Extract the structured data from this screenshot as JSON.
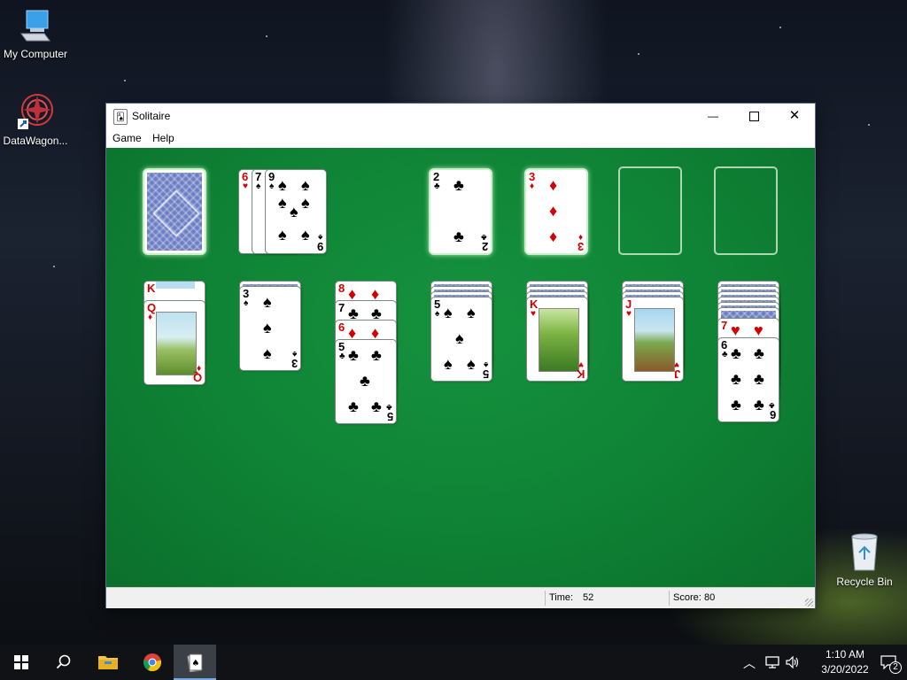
{
  "desktop": {
    "icons": [
      {
        "label": "My Computer",
        "icon": "computer-icon"
      },
      {
        "label": "DataWagon...",
        "icon": "datawagon-icon"
      },
      {
        "label": "Recycle Bin",
        "icon": "recycle-bin-icon"
      }
    ]
  },
  "window": {
    "title": "Solitaire",
    "menu": {
      "game": "Game",
      "help": "Help"
    },
    "controls": {
      "minimize": "—",
      "close": "✕"
    },
    "status": {
      "time_label": "Time:",
      "time_value": "52",
      "score_label": "Score:",
      "score_value": "80"
    }
  },
  "game": {
    "stock": "card back",
    "waste": [
      {
        "rank": "6",
        "suit": "♥",
        "color": "red"
      },
      {
        "rank": "7",
        "suit": "♠",
        "color": "black"
      },
      {
        "rank": "9",
        "suit": "♠",
        "color": "black"
      }
    ],
    "foundations": [
      {
        "rank": "2",
        "suit": "♣",
        "color": "black"
      },
      {
        "rank": "3",
        "suit": "♦",
        "color": "red"
      },
      null,
      null
    ],
    "tableau": [
      {
        "faces": [
          {
            "rank": "K",
            "suit": "♦",
            "color": "red"
          },
          {
            "rank": "Q",
            "suit": "♦",
            "color": "red"
          }
        ]
      },
      {
        "faces": [
          {
            "rank": "3",
            "suit": "♠",
            "color": "black"
          }
        ]
      },
      {
        "faces": [
          {
            "rank": "8",
            "suit": "♦",
            "color": "red"
          },
          {
            "rank": "7",
            "suit": "♣",
            "color": "black"
          },
          {
            "rank": "6",
            "suit": "♦",
            "color": "red"
          },
          {
            "rank": "5",
            "suit": "♣",
            "color": "black"
          }
        ]
      },
      {
        "faces": [
          {
            "rank": "5",
            "suit": "♠",
            "color": "black"
          }
        ]
      },
      {
        "faces": [
          {
            "rank": "K",
            "suit": "♥",
            "color": "red"
          }
        ]
      },
      {
        "faces": [
          {
            "rank": "J",
            "suit": "♥",
            "color": "red"
          }
        ]
      },
      {
        "faces": [
          {
            "rank": "7",
            "suit": "♥",
            "color": "red"
          },
          {
            "rank": "6",
            "suit": "♣",
            "color": "black"
          }
        ]
      }
    ]
  },
  "taskbar": {
    "clock_time": "1:10 AM",
    "clock_date": "3/20/2022",
    "notifications": "2"
  }
}
